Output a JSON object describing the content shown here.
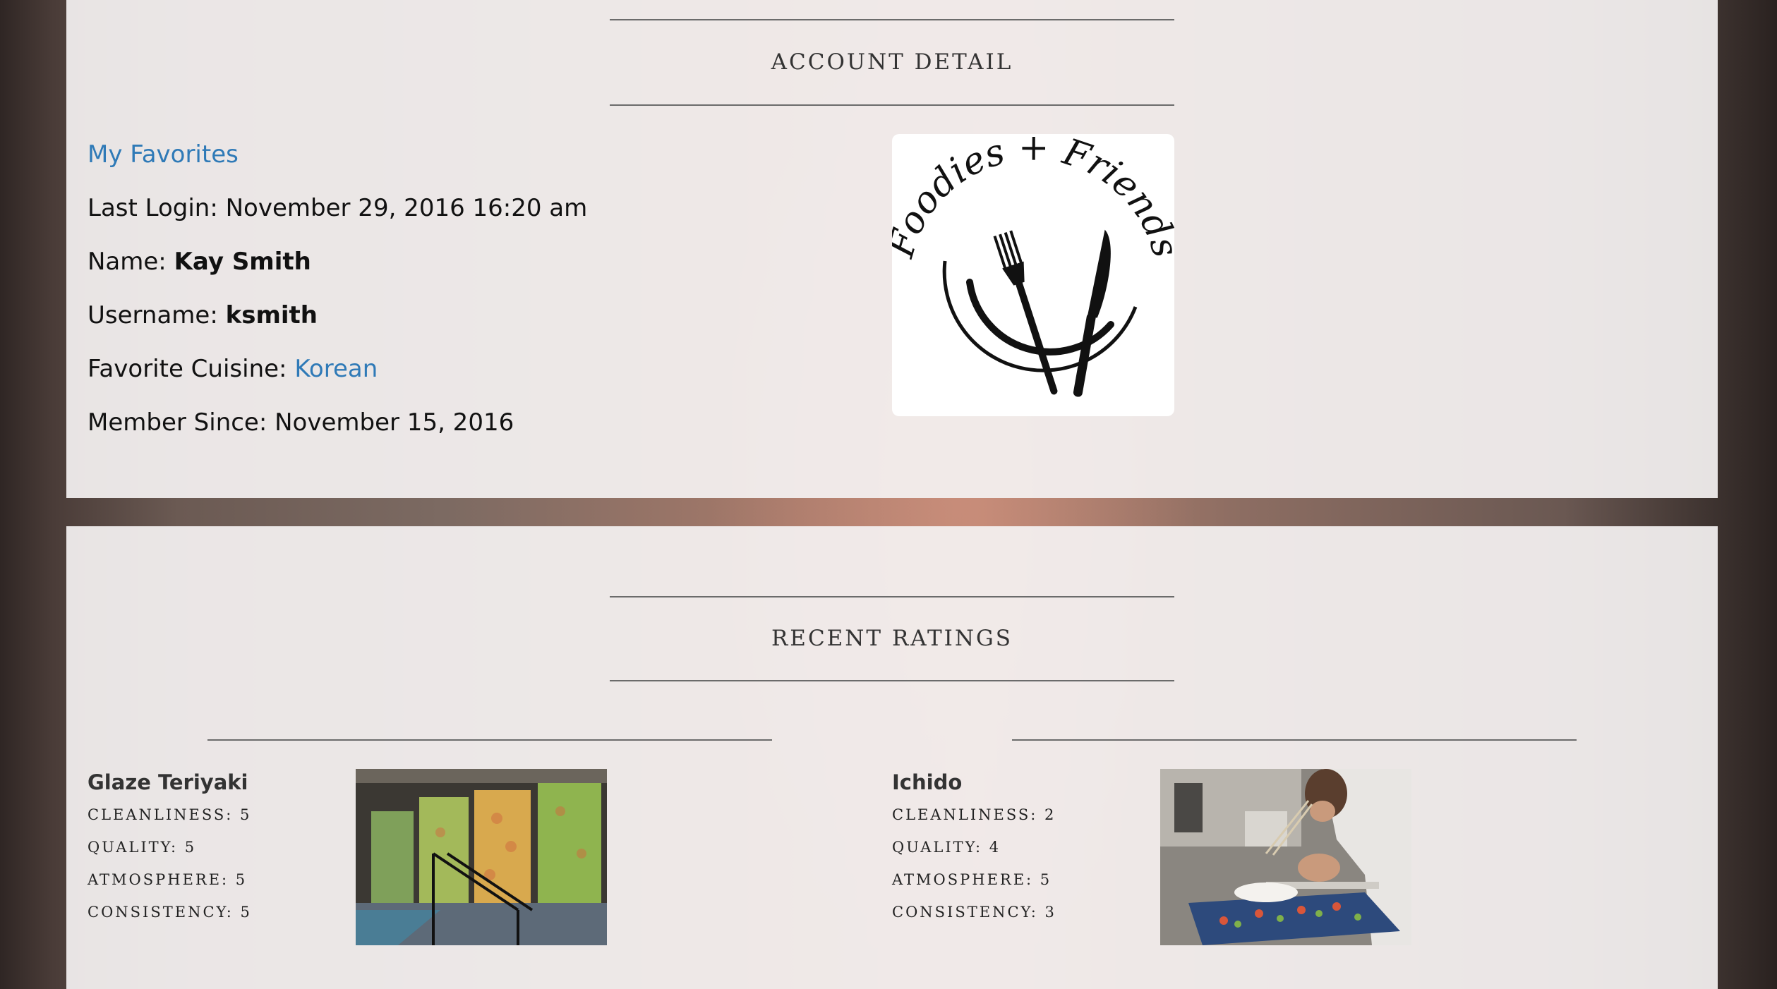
{
  "account": {
    "heading": "ACCOUNT DETAIL",
    "favorites_link": "My Favorites",
    "last_login_label": "Last Login:",
    "last_login_value": "November 29, 2016 16:20 am",
    "name_label": "Name:",
    "name_value": "Kay Smith",
    "username_label": "Username:",
    "username_value": "ksmith",
    "cuisine_label": "Favorite Cuisine:",
    "cuisine_value": "Korean",
    "member_label": "Member Since:",
    "member_value": "November 15, 2016",
    "logo_text": "Foodies + Friends"
  },
  "ratings": {
    "heading": "RECENT RATINGS",
    "items": [
      {
        "name": "Glaze Teriyaki",
        "cleanliness": "Cleanliness: 5",
        "quality": "Quality: 5",
        "atmosphere": "Atmosphere: 5",
        "consistency": "Consistency: 5"
      },
      {
        "name": "Ichido",
        "cleanliness": "Cleanliness: 2",
        "quality": "Quality: 4",
        "atmosphere": "Atmosphere: 5",
        "consistency": "Consistency: 3"
      }
    ]
  },
  "colors": {
    "link": "#2f7ab7",
    "panel": "#f4f1f1"
  }
}
